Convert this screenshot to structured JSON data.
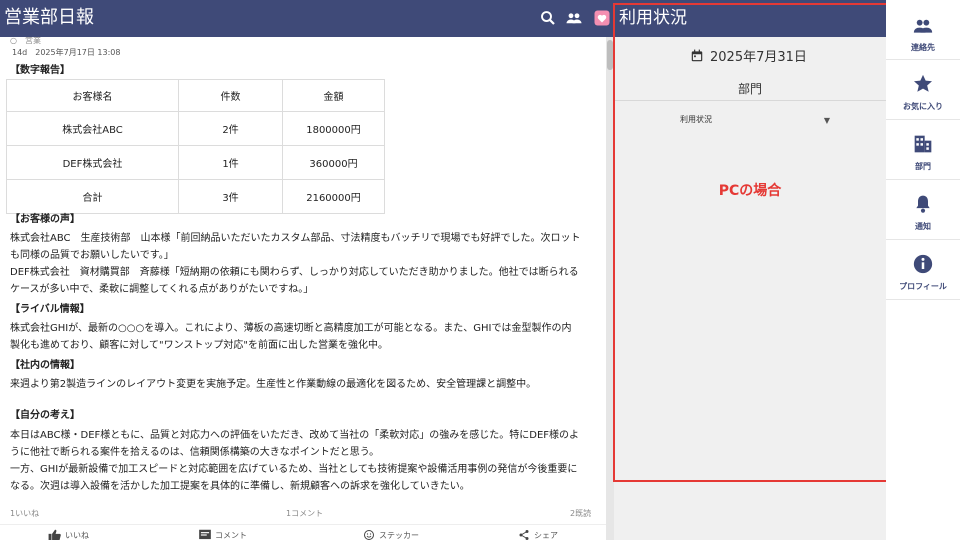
{
  "header": {
    "title": "営業部日報",
    "icons": [
      "search-icon",
      "people-icon",
      "heart-badge-icon"
    ],
    "panel_title": "利用状況"
  },
  "post": {
    "meta_top": "○　営業",
    "meta_date": "14d　2025年7月17日 13:08",
    "sections": {
      "numbers": "【数字報告】",
      "voice": "【お客様の声】",
      "rival": "【ライバル情報】",
      "internal": "【社内の情報】",
      "thoughts": "【自分の考え】"
    },
    "table": {
      "headers": [
        "お客様名",
        "件数",
        "金額"
      ],
      "rows": [
        [
          "株式会社ABC",
          "2件",
          "1800000円"
        ],
        [
          "DEF株式会社",
          "1件",
          "360000円"
        ],
        [
          "合計",
          "3件",
          "2160000円"
        ]
      ]
    },
    "voice_lines": [
      "株式会社ABC　生産技術部　山本様「前回納品いただいたカスタム部品、寸法精度もバッチリで現場でも好評でした。次ロット",
      "も同様の品質でお願いしたいです。」",
      "DEF株式会社　資材購買部　斉藤様「短納期の依頼にも関わらず、しっかり対応していただき助かりました。他社では断られる",
      "ケースが多い中で、柔軟に調整してくれる点がありがたいですね。」"
    ],
    "rival_lines": [
      "株式会社GHIが、最新の○○○を導入。これにより、薄板の高速切断と高精度加工が可能となる。また、GHIでは金型製作の内",
      "製化も進めており、顧客に対して\"ワンストップ対応\"を前面に出した営業を強化中。"
    ],
    "internal_lines": [
      "来週より第2製造ラインのレイアウト変更を実施予定。生産性と作業動線の最適化を図るため、安全管理課と調整中。"
    ],
    "thought_lines": [
      "本日はABC様・DEF様ともに、品質と対応力への評価をいただき、改めて当社の「柔軟対応」の強みを感じた。特にDEF様のよ",
      "うに他社で断られる案件を拾えるのは、信頼関係構築の大きなポイントだと思う。",
      "一方、GHIが最新設備で加工スピードと対応範囲を広げているため、当社としても技術提案や設備活用事例の発信が今後重要に",
      "なる。次週は導入設備を活かした加工提案を具体的に準備し、新規顧客への訴求を強化していきたい。"
    ],
    "stats": {
      "likes": "1いいね",
      "comments": "1コメント",
      "reads": "2既読"
    },
    "actions": {
      "like": "いいね",
      "comment": "コメント",
      "sticker": "ステッカー",
      "share": "シェア"
    }
  },
  "panel": {
    "date": "2025年7月31日",
    "department": "部門",
    "select_value": "利用状況",
    "note": "PCの場合",
    "border_color": "#e53935"
  },
  "nav": {
    "items": [
      {
        "label": "連絡先",
        "icon": "contacts-icon"
      },
      {
        "label": "お気に入り",
        "icon": "star-icon"
      },
      {
        "label": "部門",
        "icon": "building-icon"
      },
      {
        "label": "通知",
        "icon": "bell-icon"
      },
      {
        "label": "プロフィール",
        "icon": "info-icon"
      }
    ]
  },
  "colors": {
    "header_bg": "#3f4a78",
    "accent": "#e53935",
    "nav_icon": "#3f4a78"
  }
}
